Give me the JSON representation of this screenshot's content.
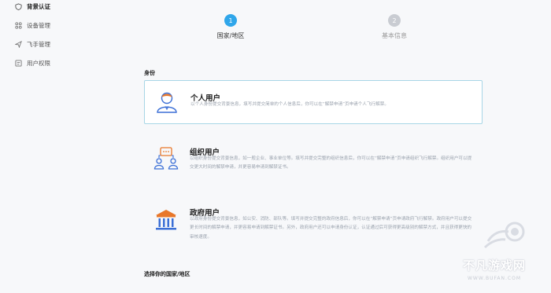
{
  "sidebar": {
    "items": [
      {
        "label": "背景认证",
        "icon": "shield-check-icon"
      },
      {
        "label": "设备管理",
        "icon": "device-icon"
      },
      {
        "label": "飞手管理",
        "icon": "pilot-icon"
      },
      {
        "label": "用户权限",
        "icon": "permission-icon"
      }
    ]
  },
  "steps": [
    {
      "number": "1",
      "label": "国家/地区"
    },
    {
      "number": "2",
      "label": "基本信息"
    }
  ],
  "identity": {
    "section_title": "身份",
    "cards": [
      {
        "title": "个人用户",
        "desc": "以个人身份提交背景信息，填写并提交简单的个人信息后，你可以在“解禁申请”页申请个人飞行解禁。",
        "icon": "personal-user-icon",
        "selected": true
      },
      {
        "title": "组织用户",
        "desc": "以组织身份提交背景信息，如一般企业、事业单位等。填写并提交完整的组织信息后，你可以在“解禁申请”页申请组织飞行解禁。组织用户可以提交更大时间的解禁申请，并更容易申请到解禁证书。",
        "icon": "organization-user-icon",
        "selected": false
      },
      {
        "title": "政府用户",
        "desc": "以政府身份提交背景信息，如公安、消防、部队等。填写并提交完整的政府信息后，你可以在“解禁申请”页申请政府飞行解禁。政府用户可以提交更长时间的解禁申请，并更容易申请到解禁证书。另外，政府用户还可以申请身份认证，认证通过后可获得更高级别的解禁方式，并且获得更快的审核速度。",
        "icon": "government-user-icon",
        "selected": false
      }
    ]
  },
  "region": {
    "section_title": "选择你的国家/地区"
  },
  "watermark": {
    "text": "不凡游戏网",
    "url": "WWW.BUFAN.COM"
  },
  "colors": {
    "accent": "#2fa6ea",
    "inactive": "#c9ccd2",
    "icon_blue": "#3b6fd6",
    "icon_orange": "#e8772a"
  }
}
